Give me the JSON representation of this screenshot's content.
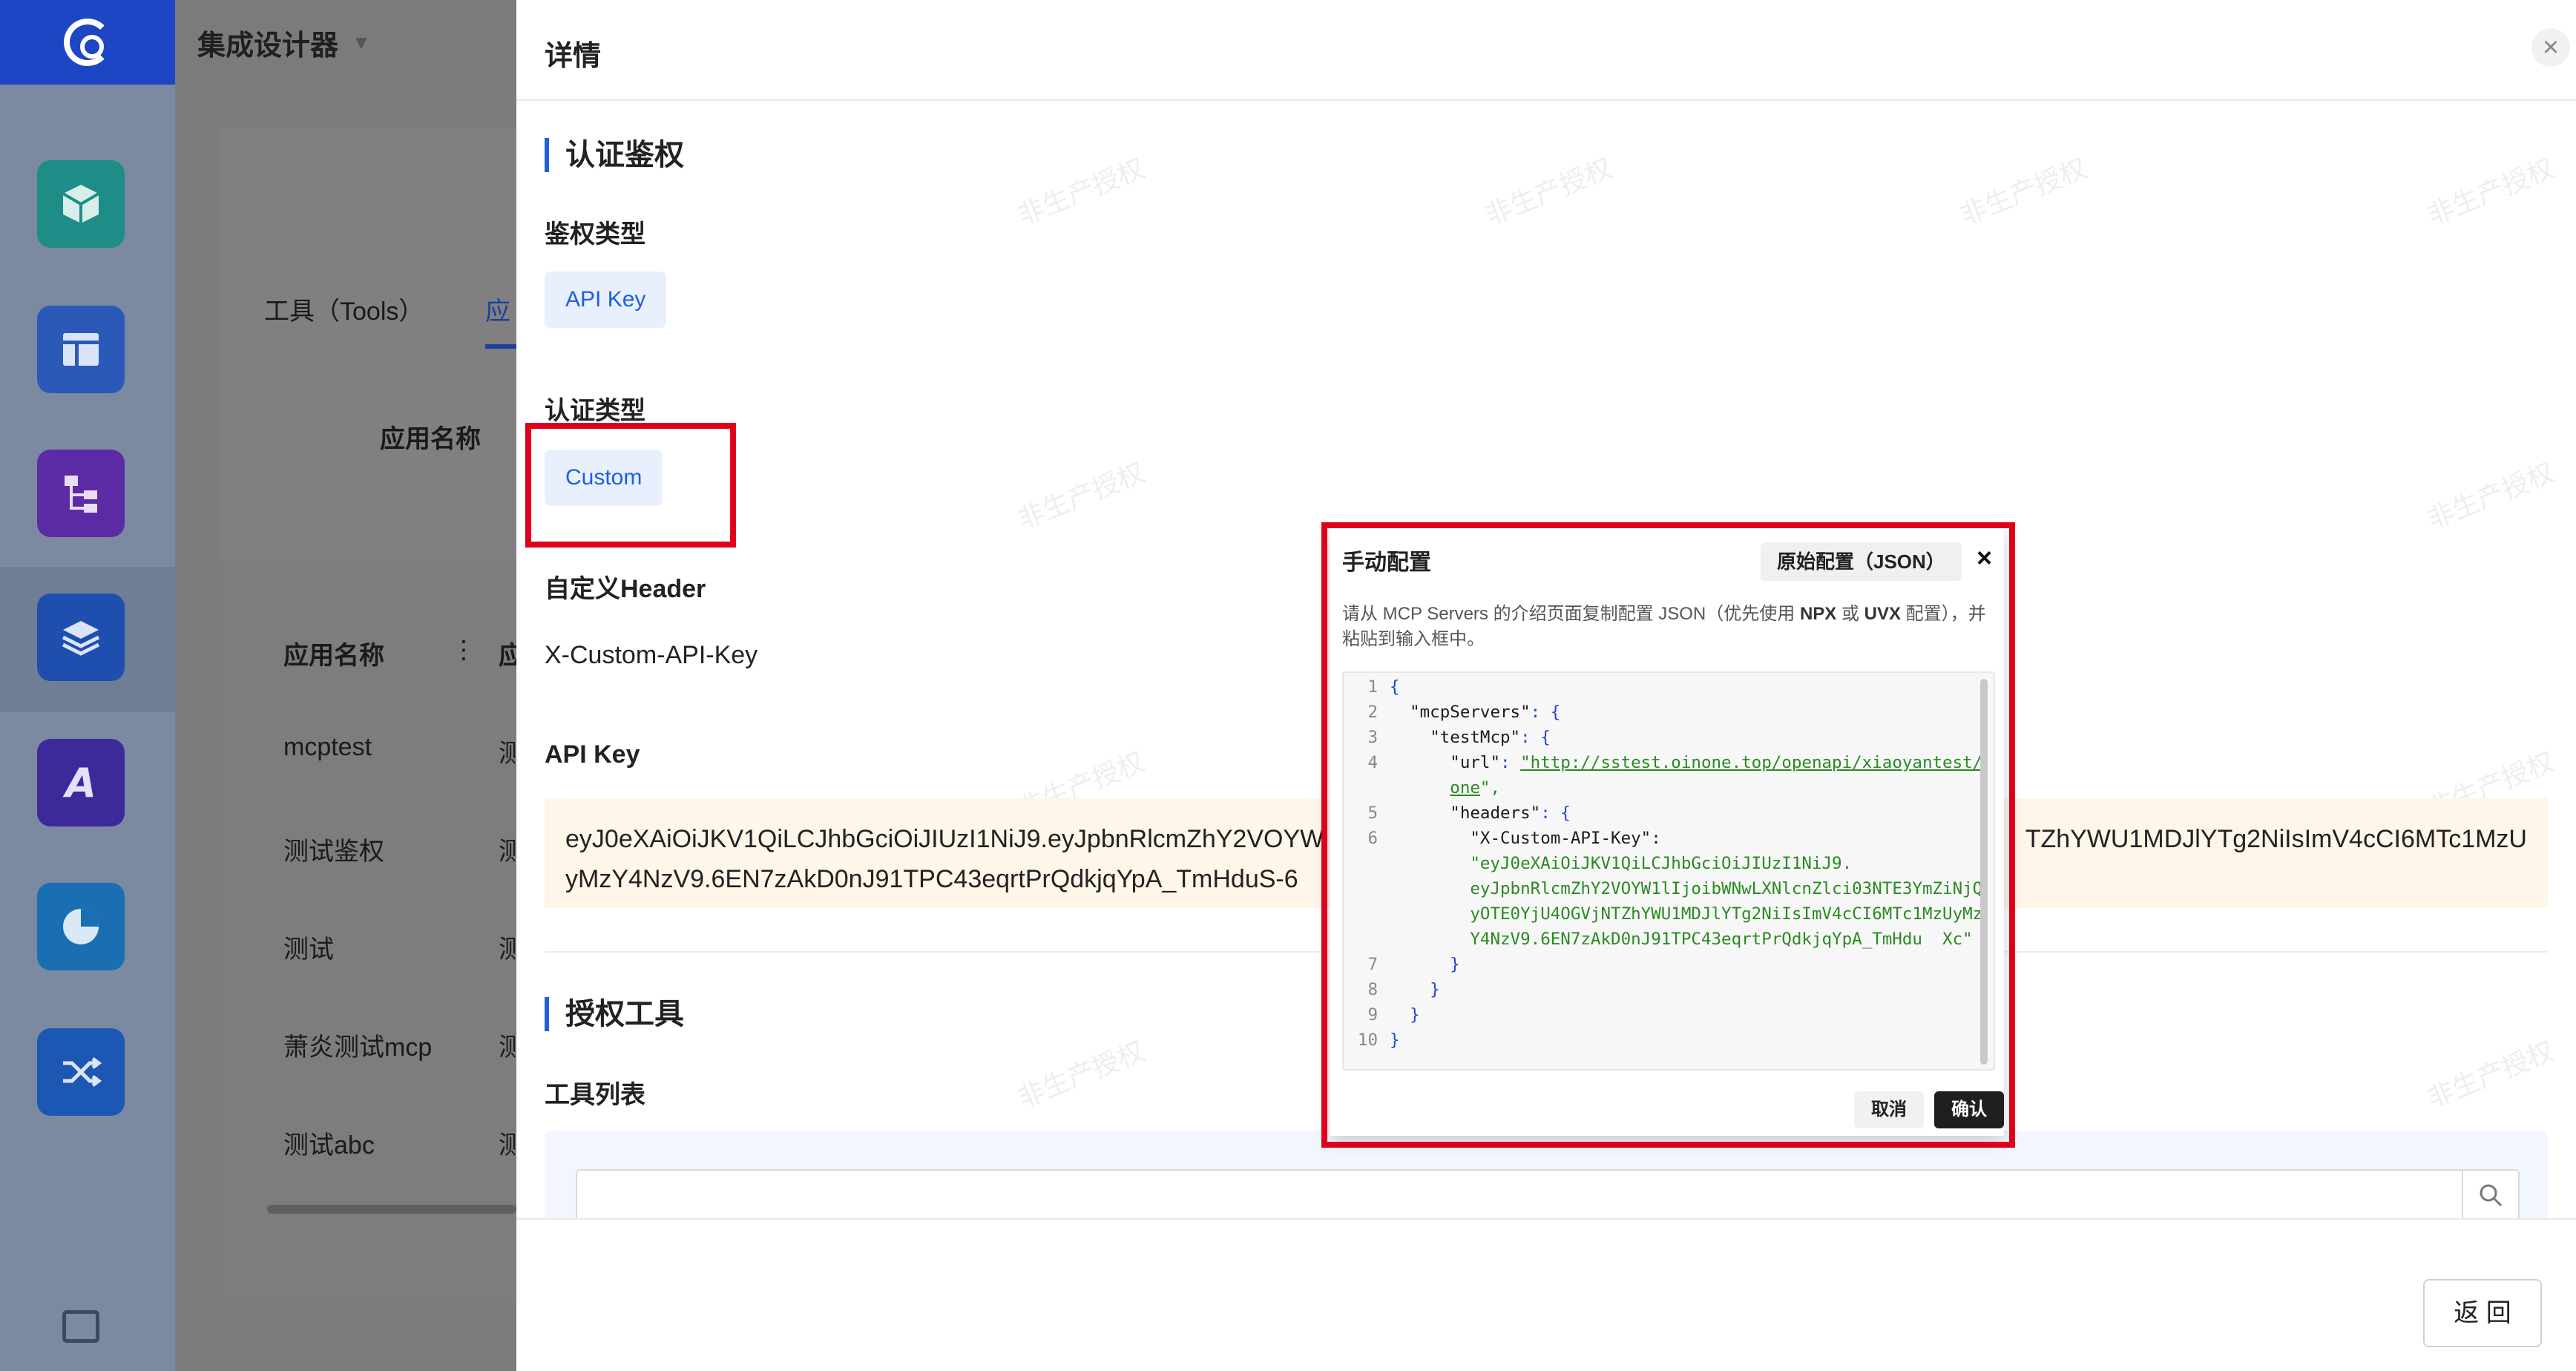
{
  "app": {
    "product_title": "集成设计器",
    "rail_icons": [
      "cube-icon",
      "layout-icon",
      "hierarchy-icon",
      "layers-icon",
      "ai-icon",
      "pie-chart-icon",
      "shuffle-icon"
    ]
  },
  "behind": {
    "tab_tools": "工具（Tools）",
    "tab_apps_partial": "应",
    "filter_label": "应用名称",
    "table_header": "应用名称",
    "table_header_next_partial": "应",
    "rows": [
      "mcptest",
      "测试鉴权",
      "测试",
      "萧炎测试mcp",
      "测试abc"
    ],
    "row_next_partial": "测"
  },
  "drawer": {
    "title": "详情",
    "section_auth": "认证鉴权",
    "auth_type_label": "鉴权类型",
    "auth_type_value": "API Key",
    "cert_type_label": "认证类型",
    "cert_type_value": "Custom",
    "header_label": "自定义Header",
    "header_value": "X-Custom-API-Key",
    "api_key_label": "API Key",
    "api_key_line1_left": "eyJ0eXAiOiJKV1QiLCJhbGciOiJIUzI1NiJ9.eyJpbnRlcmZhY2VOYW",
    "api_key_line1_right": "TZhYWU1MDJlYTg2NiIsImV4cCI6MTc1MzU",
    "api_key_line2": "yMzY4NzV9.6EN7zAkD0nJ91TPC43eqrtPrQdkjqYpA_TmHduS-6",
    "section_tools": "授权工具",
    "tools_list_label": "工具列表",
    "back_button": "返 回",
    "watermark_text": "非生产授权"
  },
  "modal": {
    "title": "手动配置",
    "raw_config_button": "原始配置（JSON）",
    "close_glyph": "×",
    "hint_part1": "请从 MCP Servers 的介绍页面复制配置 JSON（优先使用 ",
    "hint_npx": "NPX",
    "hint_mid": " 或 ",
    "hint_uvx": "UVX",
    "hint_part2": " 配置），并粘贴到输入框中。",
    "cancel_button": "取消",
    "confirm_button": "确认",
    "code": {
      "l1_ln": "1",
      "l1": "{",
      "l2_ln": "2",
      "l2_key": "\"mcpServers\"",
      "l2_rest": ": {",
      "l3_ln": "3",
      "l3_key": "\"testMcp\"",
      "l3_rest": ": {",
      "l4_ln": "4",
      "l4_key": "\"url\"",
      "l4_colon": ": ",
      "l4_url_a": "\"http://sstest.oinone.top/openapi/xiaoyantest/",
      "l4_url_b": "one",
      "l4_url_end": "\",",
      "l5_ln": "5",
      "l5_key": "\"headers\"",
      "l5_rest": ": {",
      "l6_ln": "6",
      "l6_key": "\"X-Custom-API-Key\"",
      "l6_rest": ":",
      "l6_v1": "\"eyJ0eXAiOiJKV1QiLCJhbGciOiJIUzI1NiJ9.",
      "l6_v2": "eyJpbnRlcmZhY2VOYW1lIjoibWNwLXNlcnZlci03NTE3YmZiNjQ",
      "l6_v3": "yOTE0YjU4OGVjNTZhYWU1MDJlYTg2NiIsImV4cCI6MTc1MzUyMz",
      "l6_v4": "Y4NzV9.6EN7zAkD0nJ91TPC43eqrtPrQdkjqYpA_TmHdu  Xc\"",
      "l7_ln": "7",
      "l7": "}",
      "l8_ln": "8",
      "l8": "}",
      "l9_ln": "9",
      "l9": "}",
      "l10_ln": "10",
      "l10": "}"
    }
  },
  "colors": {
    "primary": "#1f5fe0",
    "annotation_red": "#e0001b",
    "api_box_bg": "#fdf6e9"
  }
}
